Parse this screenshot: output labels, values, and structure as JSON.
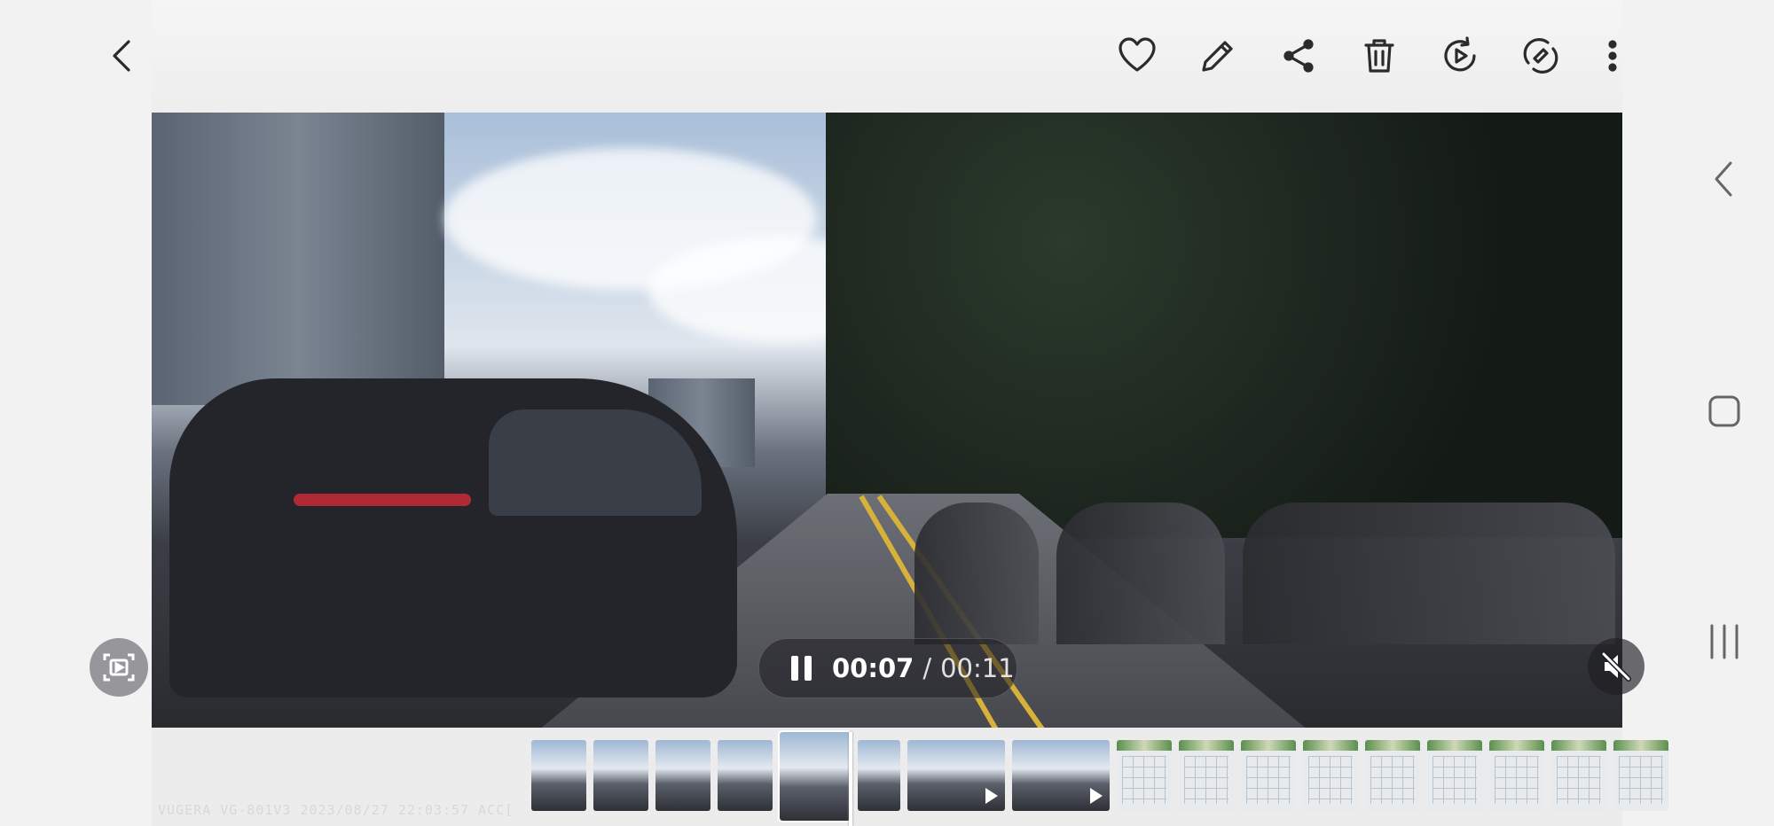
{
  "header": {
    "back_icon": "chevron-left-icon",
    "actions": [
      {
        "id": "favorite",
        "icon": "heart-icon"
      },
      {
        "id": "edit",
        "icon": "pencil-icon"
      },
      {
        "id": "share",
        "icon": "share-icon"
      },
      {
        "id": "delete",
        "icon": "trash-icon"
      },
      {
        "id": "replay",
        "icon": "replay-icon"
      },
      {
        "id": "auto-rotate",
        "icon": "rotate-icon"
      },
      {
        "id": "more",
        "icon": "more-vertical-icon"
      }
    ]
  },
  "player": {
    "current_time": "00:07",
    "separator": "/",
    "total_time": "00:11",
    "state": "playing",
    "muted": true
  },
  "filmstrip": {
    "overlay_text": "VUGERA VG-801V3 2023/08/27 22:03:57 ACC[",
    "thumbnails": [
      {
        "kind": "road"
      },
      {
        "kind": "road"
      },
      {
        "kind": "road"
      },
      {
        "kind": "road"
      },
      {
        "kind": "road",
        "current": true
      },
      {
        "kind": "road"
      },
      {
        "kind": "road",
        "video": true
      },
      {
        "kind": "road",
        "video": true
      },
      {
        "kind": "doc"
      },
      {
        "kind": "doc"
      },
      {
        "kind": "doc"
      },
      {
        "kind": "doc"
      },
      {
        "kind": "doc"
      },
      {
        "kind": "doc"
      },
      {
        "kind": "doc"
      },
      {
        "kind": "doc"
      },
      {
        "kind": "doc"
      }
    ]
  },
  "colors": {
    "toolbar_icon": "#2b2b2b",
    "pill_bg": "#1e1e22",
    "lane_yellow": "#d8b13a"
  }
}
